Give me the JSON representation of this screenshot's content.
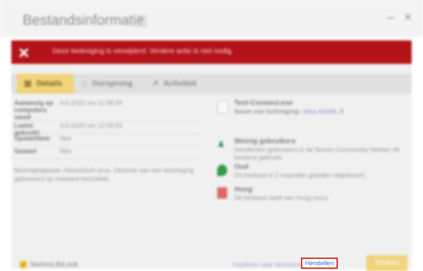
{
  "window": {
    "title": "Bestandsinformatie",
    "help_icon": "?",
    "min_label": "–",
    "close_label": "×"
  },
  "banner": {
    "icon": "×",
    "message": "Deze bedreiging is verwijderd. Verdere actie is niet nodig."
  },
  "tabs": [
    {
      "label": "Details",
      "active": true
    },
    {
      "label": "Oorsprong",
      "active": false
    },
    {
      "label": "Activiteit",
      "active": false
    }
  ],
  "details": [
    {
      "key": "Aanwezig op computers vanaf",
      "value": "4-6-2020 om 11:58:34"
    },
    {
      "key": "Laatst gebruikt",
      "value": "4-6-2020 om 12:00:55"
    },
    {
      "key": "Opstartitem",
      "value": "Nee"
    },
    {
      "key": "Gestart",
      "value": "Nee"
    }
  ],
  "description": "Bedreigingstype: Heuristisch virus. Detectie van een bedreiging gebaseerd op malware-heuristiek.",
  "file_info": {
    "name": "Test-Connect.exe",
    "threat_label": "Naam van bedreiging:",
    "threat_name": "Heur.AdvML.B"
  },
  "insights": [
    {
      "title": "Weinig gebruikers",
      "text": "Honderden gebruikers in de Norton Community hebben dit bestand gebruikt.",
      "icon": "users-icon",
      "color": "#2e8b57"
    },
    {
      "title": "Oud",
      "text": "Dit bestand is 2 maanden geleden uitgebracht.",
      "icon": "leaf-icon",
      "color": "#2e9b44"
    },
    {
      "title": "Hoog",
      "text": "Dit bestand heeft een hoog risico.",
      "icon": "risk-icon",
      "color": "#e06666"
    }
  ],
  "footer": {
    "brand": "NortonLifeLock",
    "restore_label": "Herstellen",
    "close_label": "Sluiten",
    "link_text": "Kopiëren naar klembord"
  },
  "colors": {
    "banner": "#b31217",
    "accent": "#f0d37a",
    "restore_border": "#e0322f",
    "restore_text": "#2b6fd6"
  }
}
